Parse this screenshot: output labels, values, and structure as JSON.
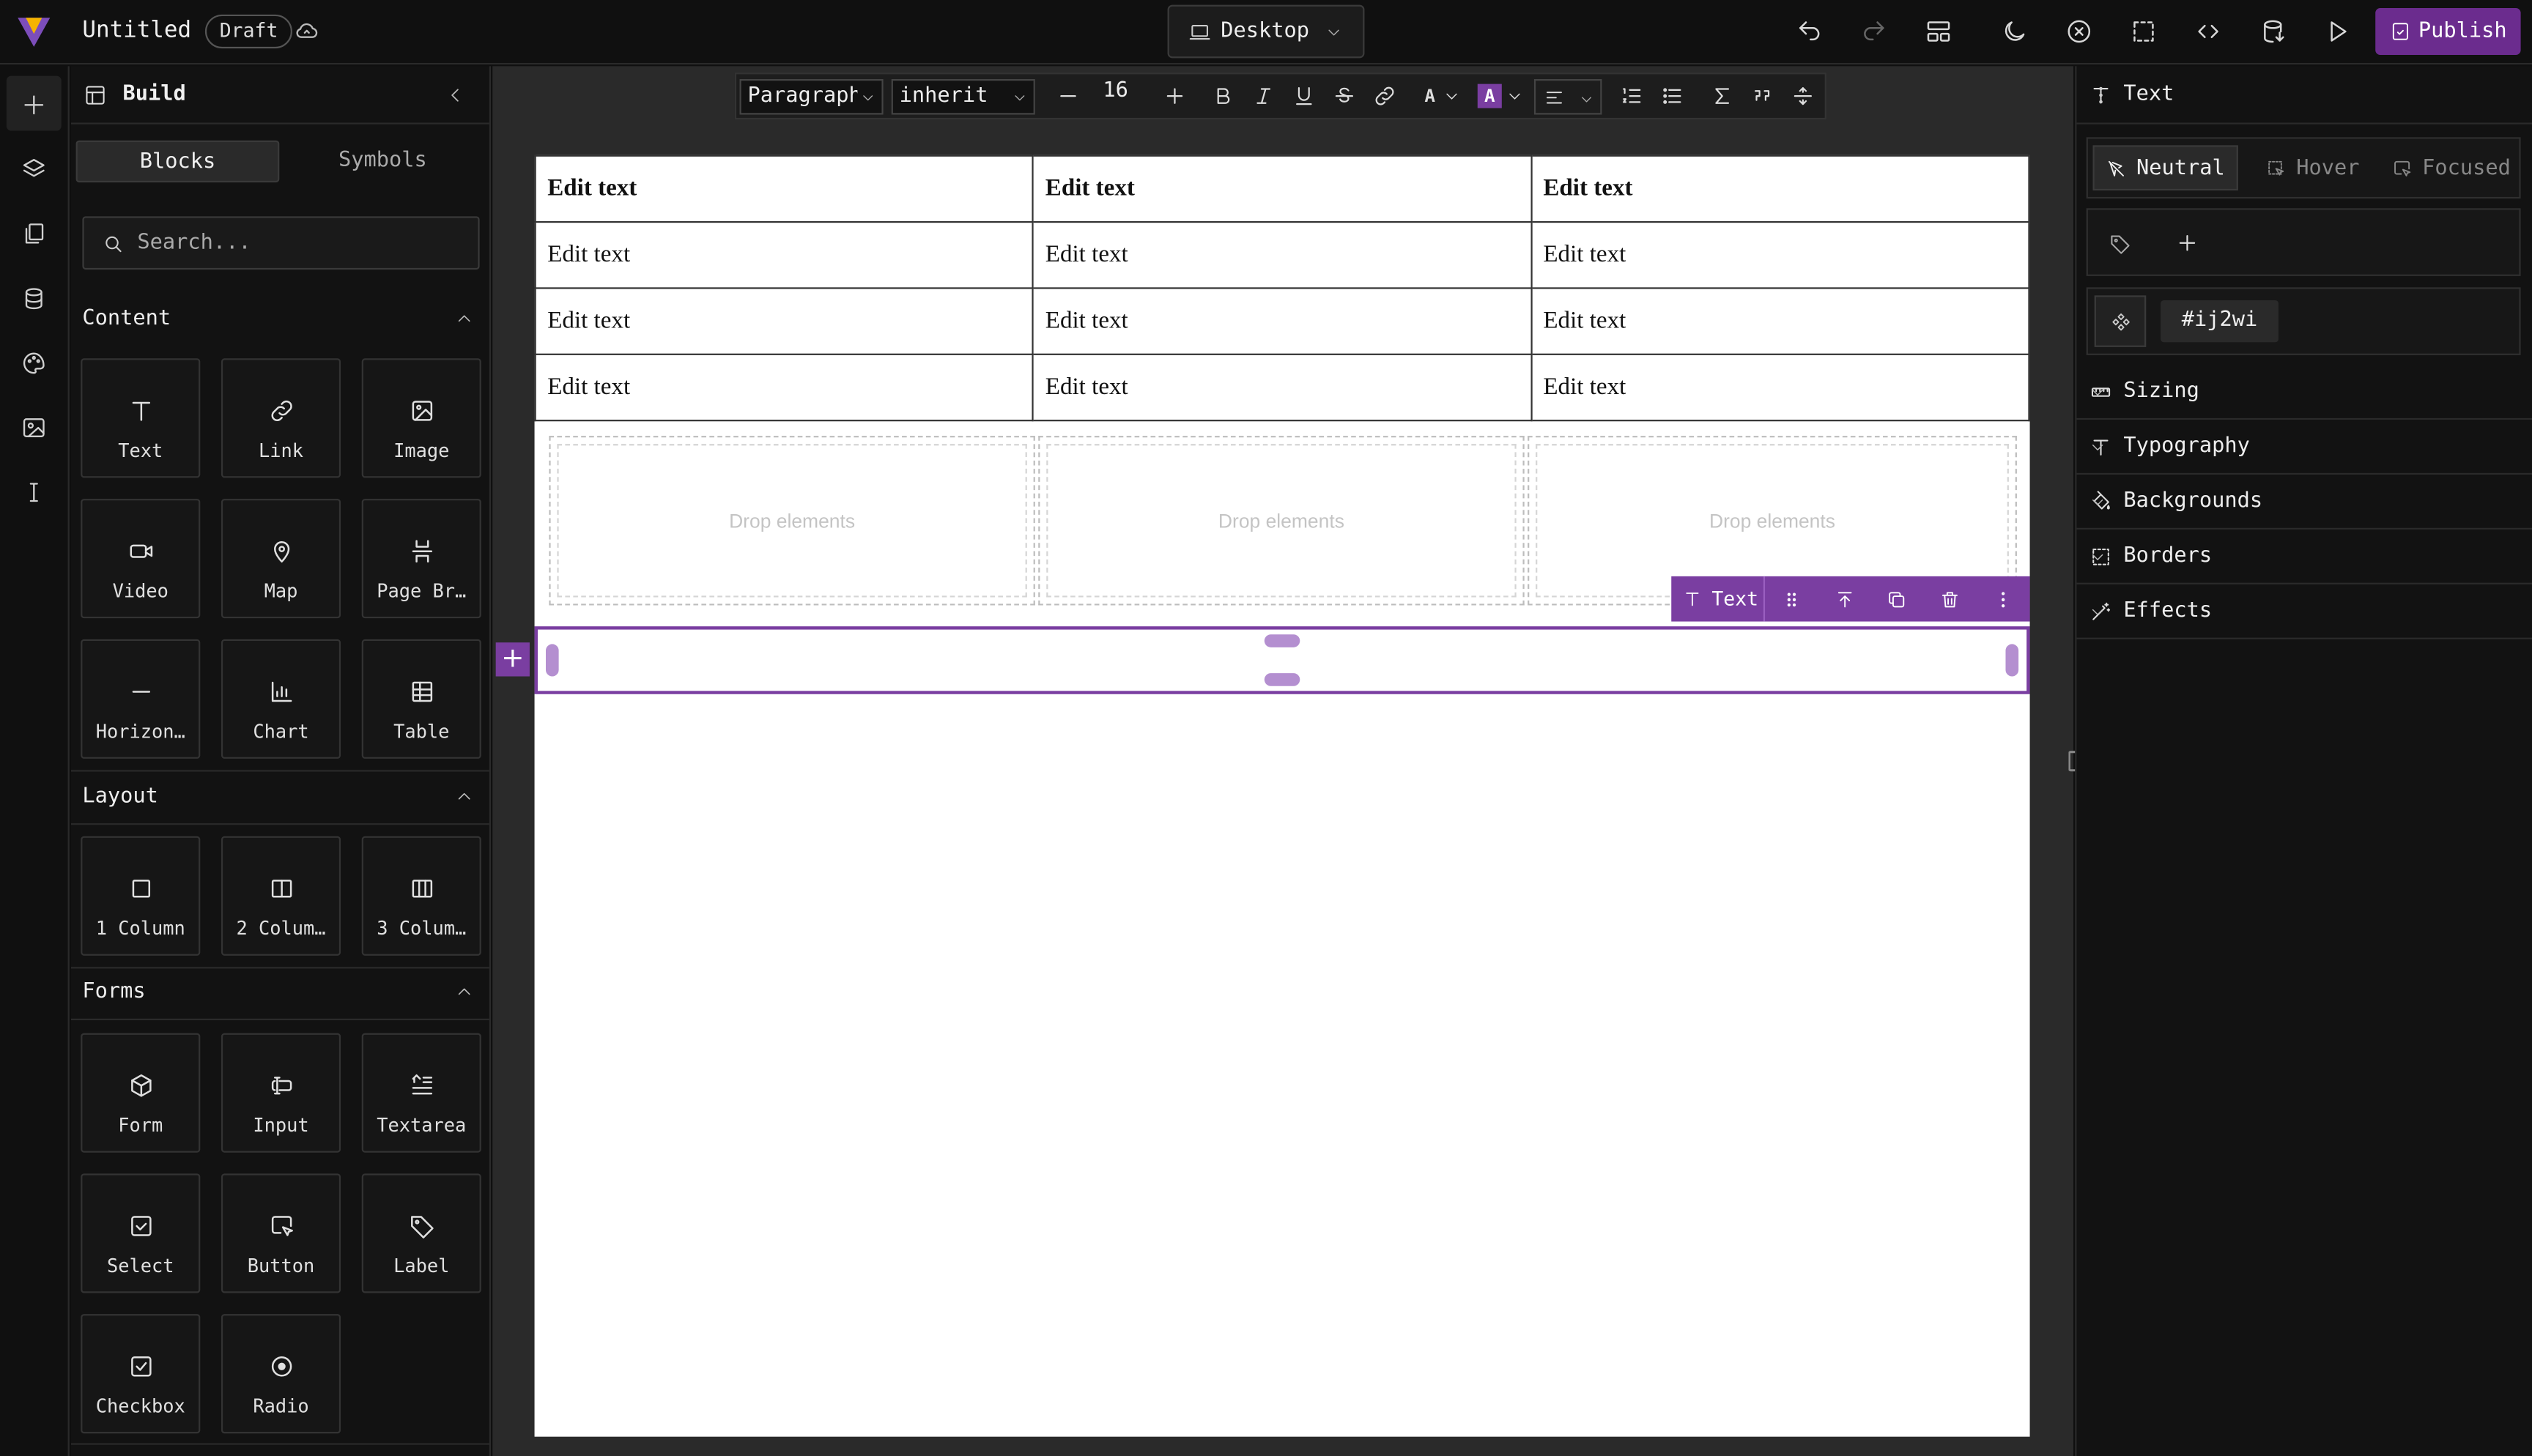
{
  "header": {
    "title": "Untitled",
    "status_badge": "Draft",
    "device": "Desktop",
    "publish_label": "Publish",
    "accent_color": "#6b2c8e",
    "icons": [
      "undo-icon",
      "redo-icon",
      "layout-icon",
      "dark-mode-icon",
      "clear-canvas-icon",
      "outline-icon",
      "code-icon",
      "import-icon",
      "preview-icon"
    ]
  },
  "rail": {
    "icons": [
      "add-icon",
      "layers-icon",
      "pages-icon",
      "database-icon",
      "palette-icon",
      "assets-icon",
      "text-cursor-icon"
    ]
  },
  "blocks_panel": {
    "title": "Build",
    "tabs": [
      "Blocks",
      "Symbols"
    ],
    "active_tab": "Blocks",
    "search_placeholder": "Search...",
    "sections": [
      {
        "title": "Content",
        "items": [
          "Text",
          "Link",
          "Image",
          "Video",
          "Map",
          "Page Br…",
          "Horizon…",
          "Chart",
          "Table"
        ]
      },
      {
        "title": "Layout",
        "items": [
          "1 Column",
          "2 Colum…",
          "3 Colum…"
        ]
      },
      {
        "title": "Forms",
        "items": [
          "Form",
          "Input",
          "Textarea",
          "Select",
          "Button",
          "Label",
          "Checkbox",
          "Radio"
        ]
      }
    ]
  },
  "editor_toolbar": {
    "block_format": "Paragraph",
    "font_family": "inherit",
    "font_size": "16",
    "text_color_glyph": "A",
    "highlight_glyph": "A"
  },
  "canvas": {
    "table": {
      "header": [
        "Edit text",
        "Edit text",
        "Edit text"
      ],
      "rows": [
        [
          "Edit text",
          "Edit text",
          "Edit text"
        ],
        [
          "Edit text",
          "Edit text",
          "Edit text"
        ],
        [
          "Edit text",
          "Edit text",
          "Edit text"
        ]
      ]
    },
    "drop_placeholders": [
      "Drop elements",
      "Drop elements",
      "Drop elements"
    ],
    "selected_element_label": "Text"
  },
  "style_panel": {
    "title": "Text",
    "states": [
      "Neutral",
      "Hover",
      "Focused"
    ],
    "active_state": "Neutral",
    "element_id": "#ij2wi",
    "sections": [
      "Sizing",
      "Typography",
      "Backgrounds",
      "Borders",
      "Effects"
    ]
  }
}
